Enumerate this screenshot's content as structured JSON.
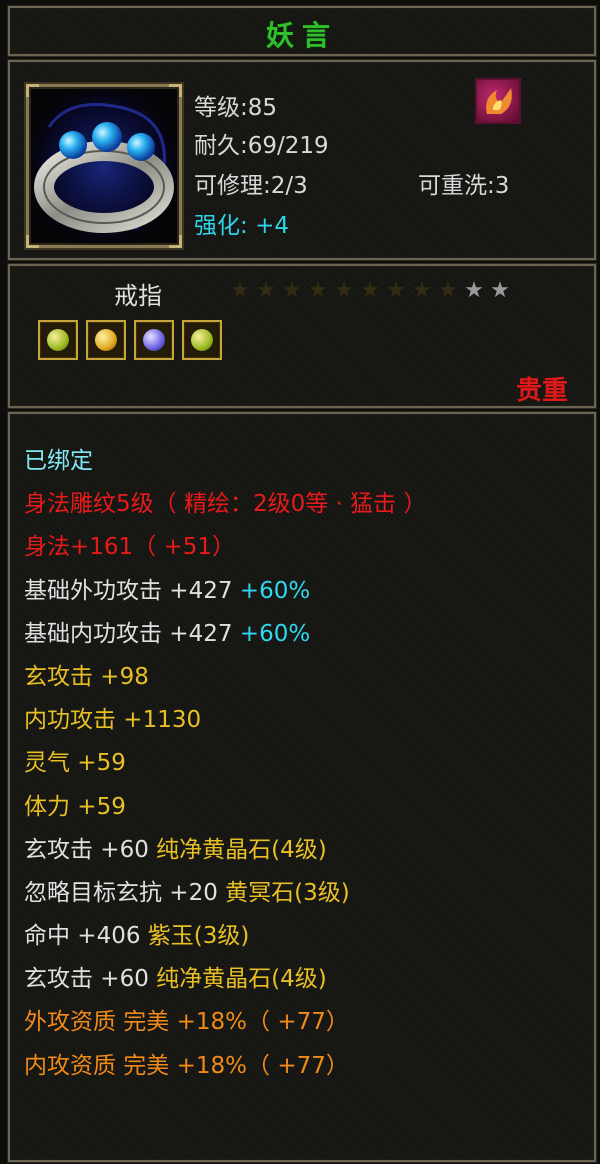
{
  "item": {
    "name": "妖言",
    "level": "等级:85",
    "durability": "耐久:69/219",
    "repairable": "可修理:2/3",
    "rewash": "可重洗:3",
    "enhance_label": "强化:",
    "enhance_value": "+4",
    "type": "戒指",
    "rarity": "贵重",
    "stars_total": 11,
    "stars_filled": 9,
    "gems": [
      "yellow-gem-icon",
      "gold-gem-icon",
      "purple-gem-icon",
      "yellow-gem-icon"
    ]
  },
  "attributes": [
    [
      {
        "text": "已绑定",
        "color": "cyan"
      }
    ],
    [
      {
        "text": "身法雕纹5级（ 精绘：2级0等 · 猛击 ）",
        "color": "red"
      }
    ],
    [
      {
        "text": "身法+161（ +51）",
        "color": "red"
      }
    ],
    [
      {
        "text": "基础外功攻击 +427 ",
        "color": "gray"
      },
      {
        "text": "+60%",
        "color": "teal"
      }
    ],
    [
      {
        "text": "基础内功攻击 +427 ",
        "color": "gray"
      },
      {
        "text": "+60%",
        "color": "teal"
      }
    ],
    [
      {
        "text": "玄攻击 +98",
        "color": "yellow"
      }
    ],
    [
      {
        "text": "内功攻击 +1130",
        "color": "yellow"
      }
    ],
    [
      {
        "text": "灵气 +59",
        "color": "yellow"
      }
    ],
    [
      {
        "text": "体力 +59",
        "color": "yellow"
      }
    ],
    [
      {
        "text": "玄攻击 +60 ",
        "color": "gray"
      },
      {
        "text": "纯净黄晶石(4级)",
        "color": "yellow"
      }
    ],
    [
      {
        "text": "忽略目标玄抗 +20 ",
        "color": "gray"
      },
      {
        "text": "黄冥石(3级)",
        "color": "yellow"
      }
    ],
    [
      {
        "text": "命中 +406 ",
        "color": "gray"
      },
      {
        "text": "紫玉(3级)",
        "color": "yellow"
      }
    ],
    [
      {
        "text": "玄攻击 +60 ",
        "color": "gray"
      },
      {
        "text": "纯净黄晶石(4级)",
        "color": "yellow"
      }
    ],
    [
      {
        "text": "外攻资质  完美 +18%（ +77）",
        "color": "orange"
      }
    ],
    [
      {
        "text": "内攻资质  完美 +18%（ +77）",
        "color": "orange"
      }
    ]
  ],
  "colors": {
    "title_green": "#2fbf2a",
    "rarity_red": "#e01818",
    "star_gold": "#d8a820",
    "frame": "#6b6452"
  }
}
